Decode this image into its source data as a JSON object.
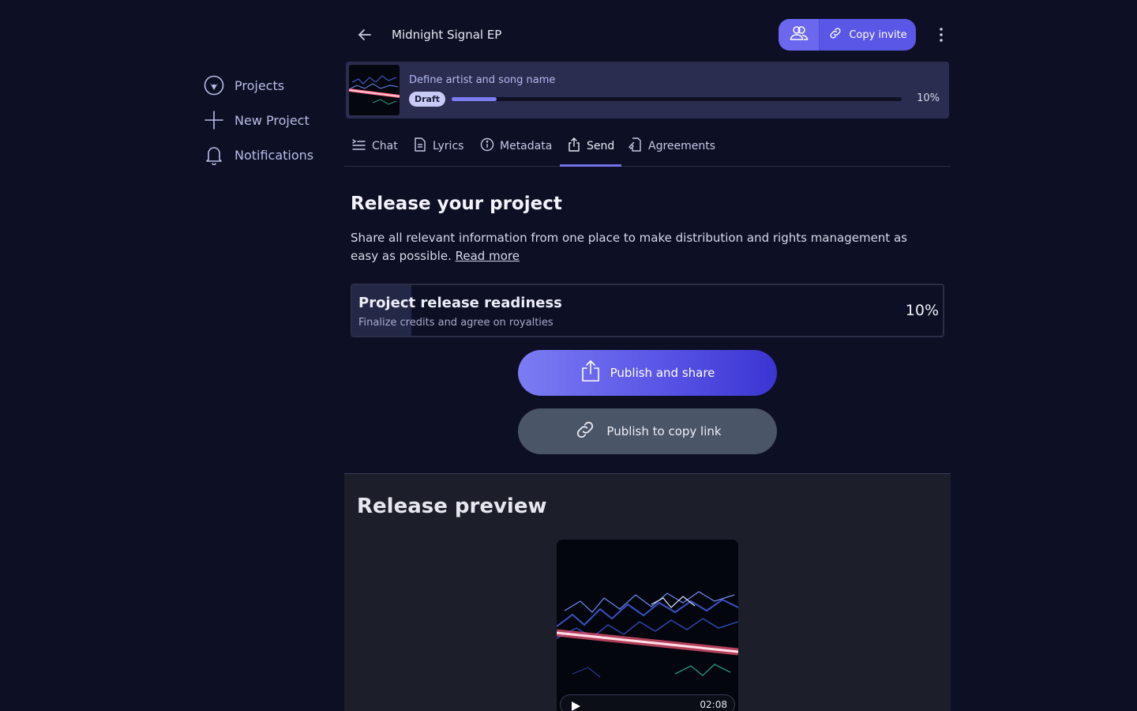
{
  "sidebar": {
    "items": [
      {
        "label": "Projects",
        "icon": "heart-shield-icon"
      },
      {
        "label": "New Project",
        "icon": "plus-icon"
      },
      {
        "label": "Notifications",
        "icon": "bell-icon"
      }
    ]
  },
  "header": {
    "title": "Midnight Signal EP",
    "copy_invite_label": "Copy invite"
  },
  "status": {
    "title": "Define artist and song name",
    "badge": "Draft",
    "progress": 0.1,
    "progress_label": "10%"
  },
  "tabs": [
    {
      "label": "Chat",
      "icon": "chat-lines-icon"
    },
    {
      "label": "Lyrics",
      "icon": "document-icon"
    },
    {
      "label": "Metadata",
      "icon": "info-icon"
    },
    {
      "label": "Send",
      "icon": "share-icon",
      "active": true
    },
    {
      "label": "Agreements",
      "icon": "contract-icon"
    }
  ],
  "release": {
    "title": "Release your project",
    "description": "Share all relevant information from one place to make distribution and rights management as easy as possible.",
    "read_more": "Read more"
  },
  "readiness": {
    "title": "Project release readiness",
    "subtitle": "Finalize credits and agree on royalties",
    "percent_label": "10%",
    "percent": 0.1
  },
  "actions": {
    "publish_share": "Publish and share",
    "publish_link": "Publish to copy link"
  },
  "preview": {
    "title": "Release preview",
    "duration": "02:08"
  },
  "colors": {
    "background": "#0d0f24",
    "accent": "#5b57e6",
    "card": "#2a2d4f"
  }
}
